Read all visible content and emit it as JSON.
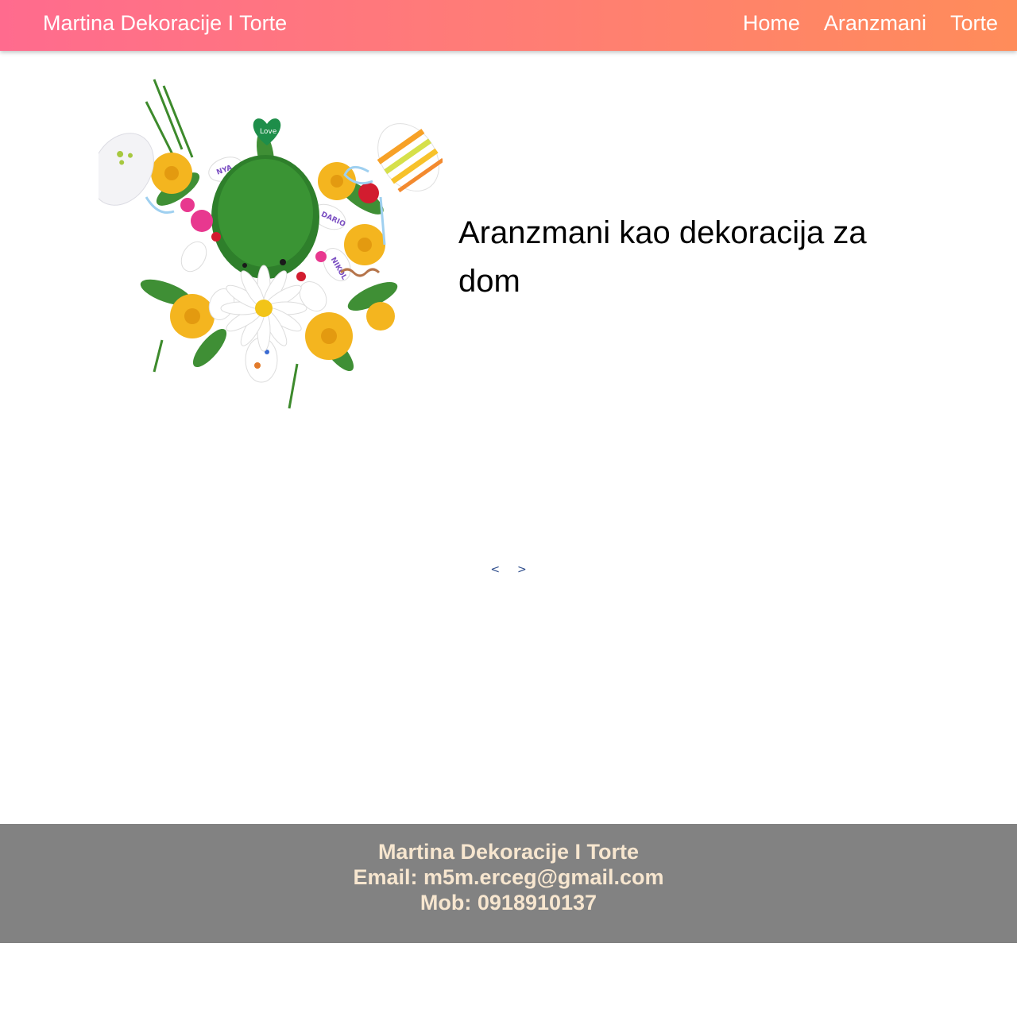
{
  "navbar": {
    "brand": "Martina Dekoracije I Torte",
    "links": [
      "Home",
      "Aranzmani",
      "Torte"
    ]
  },
  "slider": {
    "image_icon": "easter-flower-arrangement",
    "caption": "Aranzmani kao dekoracija za dom",
    "prev_label": "<",
    "next_label": ">"
  },
  "footer": {
    "name": "Martina Dekoracije I Torte",
    "email_line": "Email: m5m.erceg@gmail.com",
    "phone_line": "Mob: 0918910137"
  },
  "colors": {
    "navbar_gradient_start": "#ff6b8e",
    "navbar_gradient_end": "#ff8c5a",
    "footer_bg": "#828282",
    "footer_text": "#f7e6cf",
    "slider_control": "#2b4a8a"
  }
}
